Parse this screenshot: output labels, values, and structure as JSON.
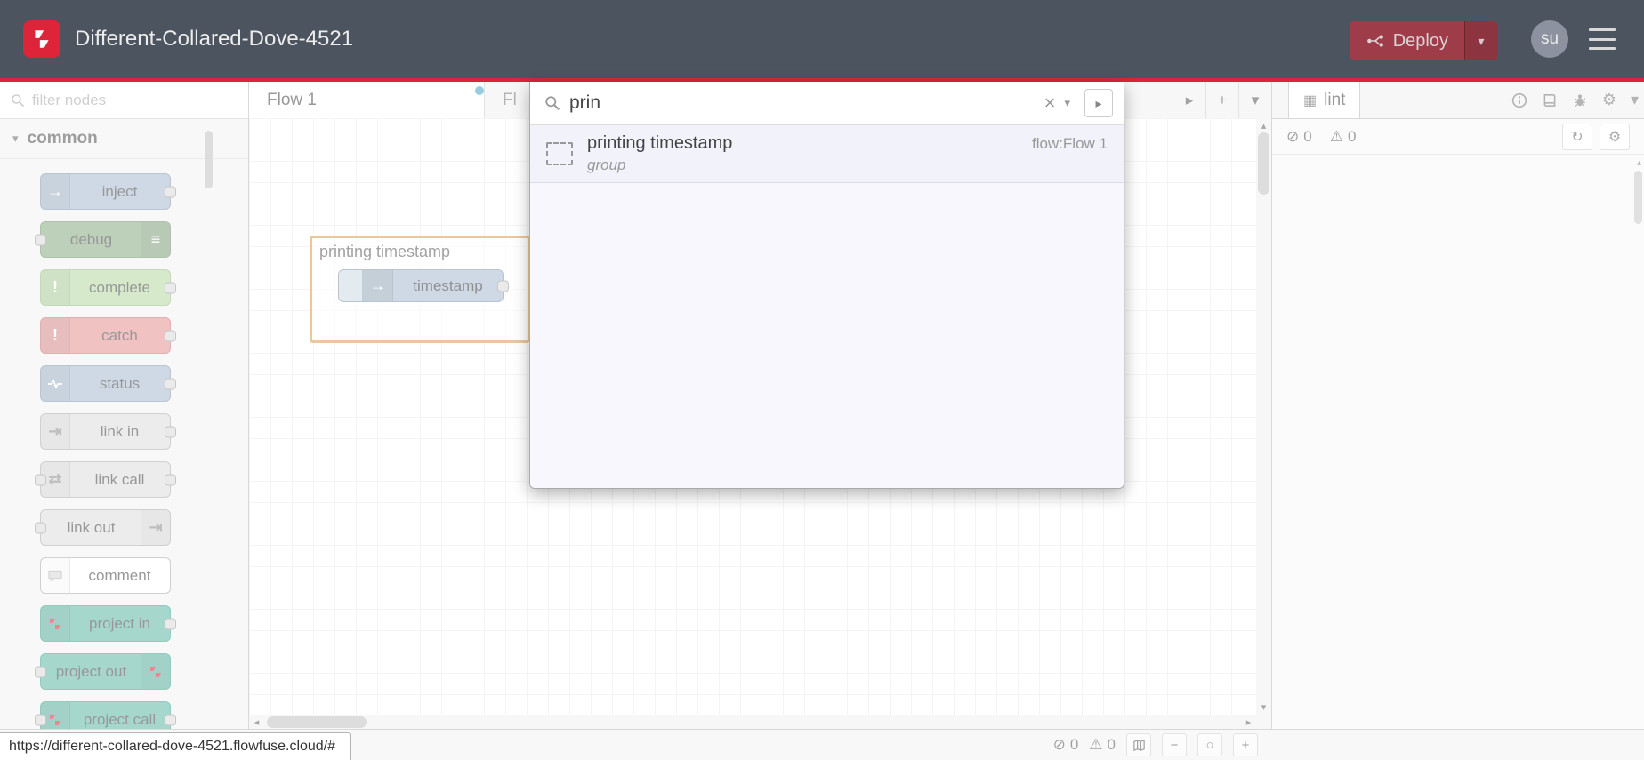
{
  "colors": {
    "header_bg": "#4c545f",
    "accent_red": "#d7263d",
    "deploy_bg": "#9e3c49",
    "group_highlight": "#d99a4d",
    "tab_dot": "#45a3c4",
    "node_inject": "#a6bbcf",
    "node_debug": "#87a980",
    "node_complete": "#b5d7a0",
    "node_catch": "#e49191",
    "node_status": "#a6bbcf",
    "node_link": "#dddddd",
    "node_comment": "#ffffff",
    "node_project": "#5cb6a4"
  },
  "header": {
    "title": "Different-Collared-Dove-4521",
    "deploy": {
      "label": "Deploy"
    },
    "avatar": "su"
  },
  "palette": {
    "filter_placeholder": "filter nodes",
    "category": "common",
    "nodes": [
      {
        "label": "inject",
        "color": "#a6bbcf"
      },
      {
        "label": "debug",
        "color": "#87a980"
      },
      {
        "label": "complete",
        "color": "#b5d7a0"
      },
      {
        "label": "catch",
        "color": "#e49191"
      },
      {
        "label": "status",
        "color": "#a6bbcf"
      },
      {
        "label": "link in",
        "color": "#dddddd"
      },
      {
        "label": "link call",
        "color": "#dddddd"
      },
      {
        "label": "link out",
        "color": "#dddddd"
      },
      {
        "label": "comment",
        "color": "#ffffff"
      },
      {
        "label": "project in",
        "color": "#5cb6a4"
      },
      {
        "label": "project out",
        "color": "#5cb6a4"
      },
      {
        "label": "project call",
        "color": "#5cb6a4"
      }
    ]
  },
  "workspace": {
    "tabs": [
      {
        "label": "Flow 1"
      },
      {
        "label": "Fl"
      }
    ],
    "group_label": "printing timestamp",
    "node_label": "timestamp"
  },
  "search": {
    "query": "prin",
    "results": [
      {
        "title": "printing timestamp",
        "subtitle": "group",
        "flow": "flow:Flow 1"
      }
    ]
  },
  "sidebar": {
    "tab_label": "lint",
    "error_count": "0",
    "warning_count": "0"
  },
  "footer": {
    "error_count": "0",
    "warning_count": "0"
  },
  "statusbar": {
    "url": "https://different-collared-dove-4521.flowfuse.cloud/#"
  },
  "icons": {
    "chevron_down": "▾",
    "chevron_right": "▸",
    "chevron_left": "◂",
    "chevron_up": "▴",
    "plus": "+",
    "gear": "⚙",
    "refresh": "↻",
    "warning": "⚠",
    "ban": "⊘",
    "clear": "×",
    "zoom_out": "−",
    "zoom_reset": "○",
    "zoom_in": "+",
    "inject_arrow": "→",
    "debug_lines": "≡",
    "exclamation": "!",
    "link_in": "⇥",
    "link_call": "⇄",
    "link_out": "⇥",
    "lint_tab": "▦"
  }
}
